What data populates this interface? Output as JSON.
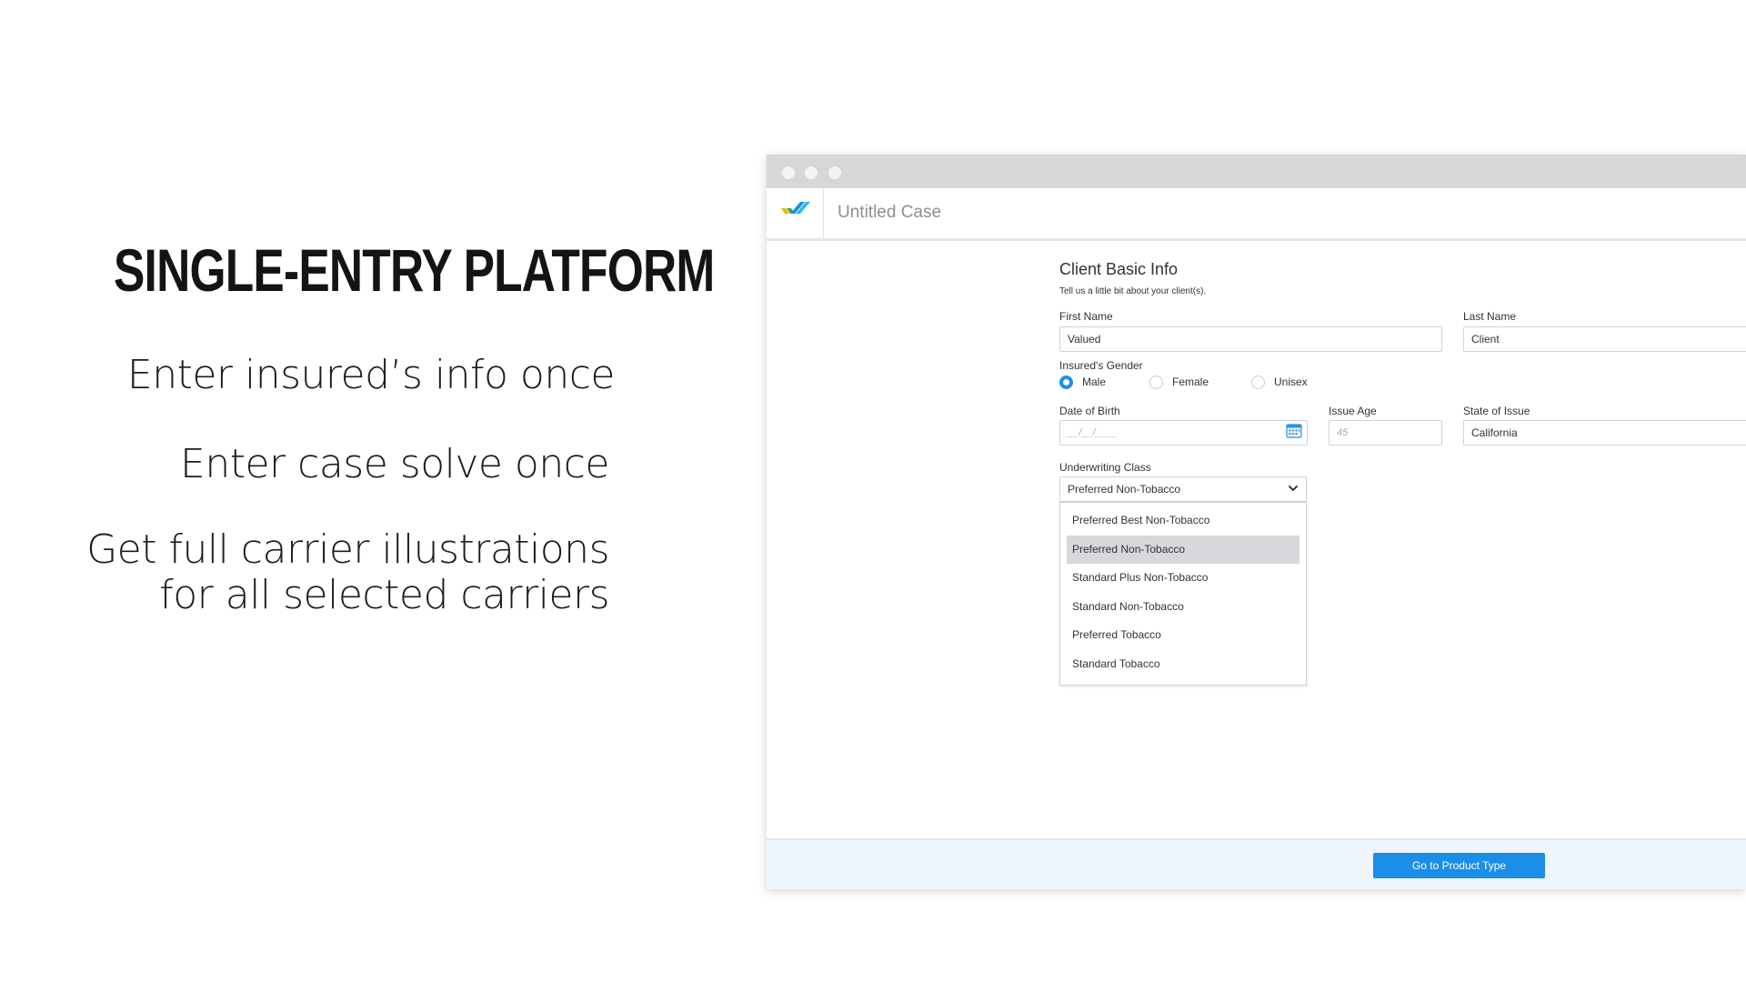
{
  "slide": {
    "headline": "SINGLE-ENTRY PLATFORM",
    "bullets": [
      "Enter insured’s info once",
      "Enter case solve once",
      "Get full carrier illustrations",
      "for all selected carriers"
    ]
  },
  "app": {
    "case_title": "Untitled Case",
    "accent_color": "#1b8ee8",
    "logo_icon": "check-stripes-logo"
  },
  "form": {
    "title": "Client Basic Info",
    "subtitle": "Tell us a little bit about your client(s).",
    "first_name": {
      "label": "First Name",
      "value": "Valued"
    },
    "last_name": {
      "label": "Last Name",
      "value": "Client"
    },
    "gender": {
      "label": "Insured's Gender",
      "options": [
        "Male",
        "Female",
        "Unisex"
      ],
      "selected": "Male"
    },
    "dob": {
      "label": "Date of Birth",
      "placeholder": "__/__/____"
    },
    "issue_age": {
      "label": "Issue Age",
      "placeholder": "45"
    },
    "state": {
      "label": "State of Issue",
      "value": "California"
    },
    "underwriting": {
      "label": "Underwriting Class",
      "value": "Preferred Non-Tobacco",
      "options": [
        "Preferred Best Non-Tobacco",
        "Preferred Non-Tobacco",
        "Standard Plus Non-Tobacco",
        "Standard Non-Tobacco",
        "Preferred Tobacco",
        "Standard Tobacco"
      ],
      "highlighted": "Preferred Non-Tobacco"
    }
  },
  "footer": {
    "cta_label": "Go to Product Type"
  }
}
